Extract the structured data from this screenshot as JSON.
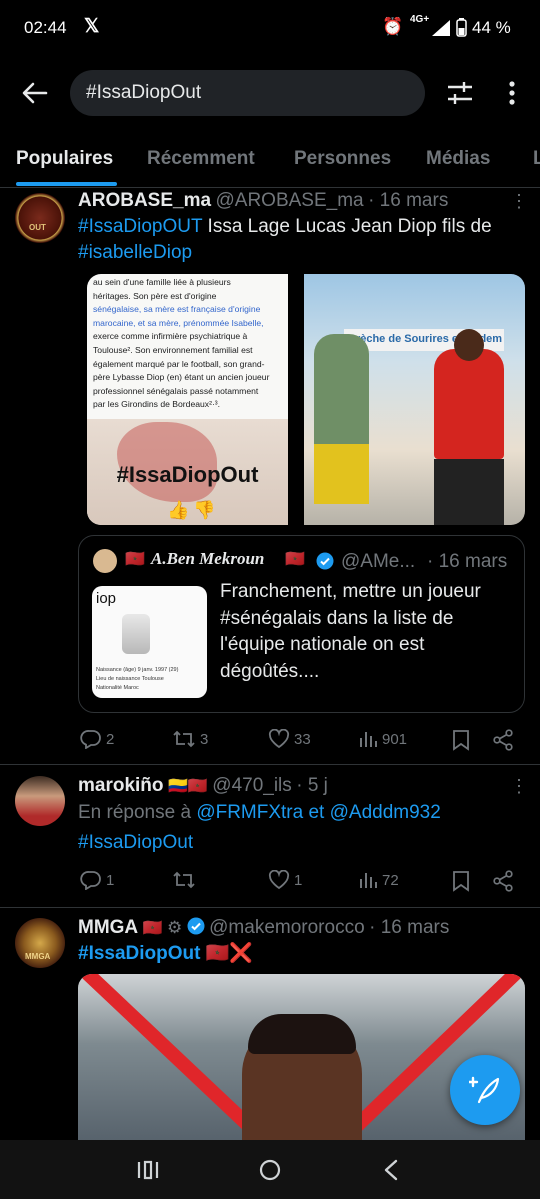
{
  "status": {
    "time": "02:44",
    "network": "4G+",
    "battery": "44 %"
  },
  "search": {
    "query": "#IssaDiopOut"
  },
  "tabs": [
    "Populaires",
    "Récemment",
    "Personnes",
    "Médias",
    "L"
  ],
  "tweets": [
    {
      "name": "AROBASE_ma",
      "handle": "@AROBASE_ma",
      "date": "· 16 mars",
      "text_hashtag1": "#IssaDiopOUT",
      "text_plain": " Issa Lage Lucas Jean Diop fils de",
      "text_hashtag2": "#isabelleDiop",
      "image1": {
        "lines": [
          "au sein d'une famille liée à plusieurs",
          "héritages. Son père est d'origine",
          "sénégalaise, sa mère est française d'origine",
          "marocaine, et sa mère, prénommée Isabelle,",
          "exerce comme infirmière psychiatrique à",
          "Toulouse². Son environnement familial est",
          "également marqué par le football, son grand-",
          "père Lybasse Diop (en) étant un ancien joueur",
          "professionnel sénégalais passé notamment",
          "par les Girondins de Bordeaux²·³."
        ],
        "hashtag": "#IssaDiopOut"
      },
      "image2": {
        "sign": "Crèche de Sourires et Gâdem"
      },
      "quote": {
        "name": "A.Ben Mekroun",
        "handle": "@AMe...",
        "date": "· 16 mars",
        "text": "Franchement, mettre un joueur #sénégalais dans la liste de l'équipe nationale on est dégoûtés....",
        "thumb_title": "iop",
        "thumb_lines": [
          "Naissance (âge) 9 janv. 1997 (29)",
          "Lieu de naissance Toulouse",
          "Nationalité Maroc"
        ]
      },
      "stats": {
        "replies": "2",
        "retweets": "3",
        "likes": "33",
        "views": "901"
      }
    },
    {
      "name": "marokiño",
      "flags": "🇨🇴🇲🇦",
      "handle": "@470_ils",
      "date": "· 5 j",
      "reply_prefix": "En réponse à ",
      "reply_to": "@FRMFXtra et @Adddm932",
      "text_hashtag": "#IssaDiopOut",
      "stats": {
        "replies": "1",
        "retweets": "",
        "likes": "1",
        "views": "72"
      }
    },
    {
      "name": "MMGA",
      "handle": "@makemororocco",
      "date": "· 16 mars",
      "text_hashtag": "#IssaDiopOut",
      "text_suffix": "🇲🇦❌"
    }
  ],
  "colors": {
    "accent": "#1d9bf0",
    "muted": "#71767b",
    "text": "#e7e9ea",
    "background": "#000000"
  },
  "icons": [
    "back-arrow-icon",
    "filter-sliders-icon",
    "more-vertical-icon",
    "reply-icon",
    "retweet-icon",
    "like-icon",
    "views-icon",
    "bookmark-icon",
    "share-icon",
    "compose-icon",
    "verified-icon"
  ]
}
